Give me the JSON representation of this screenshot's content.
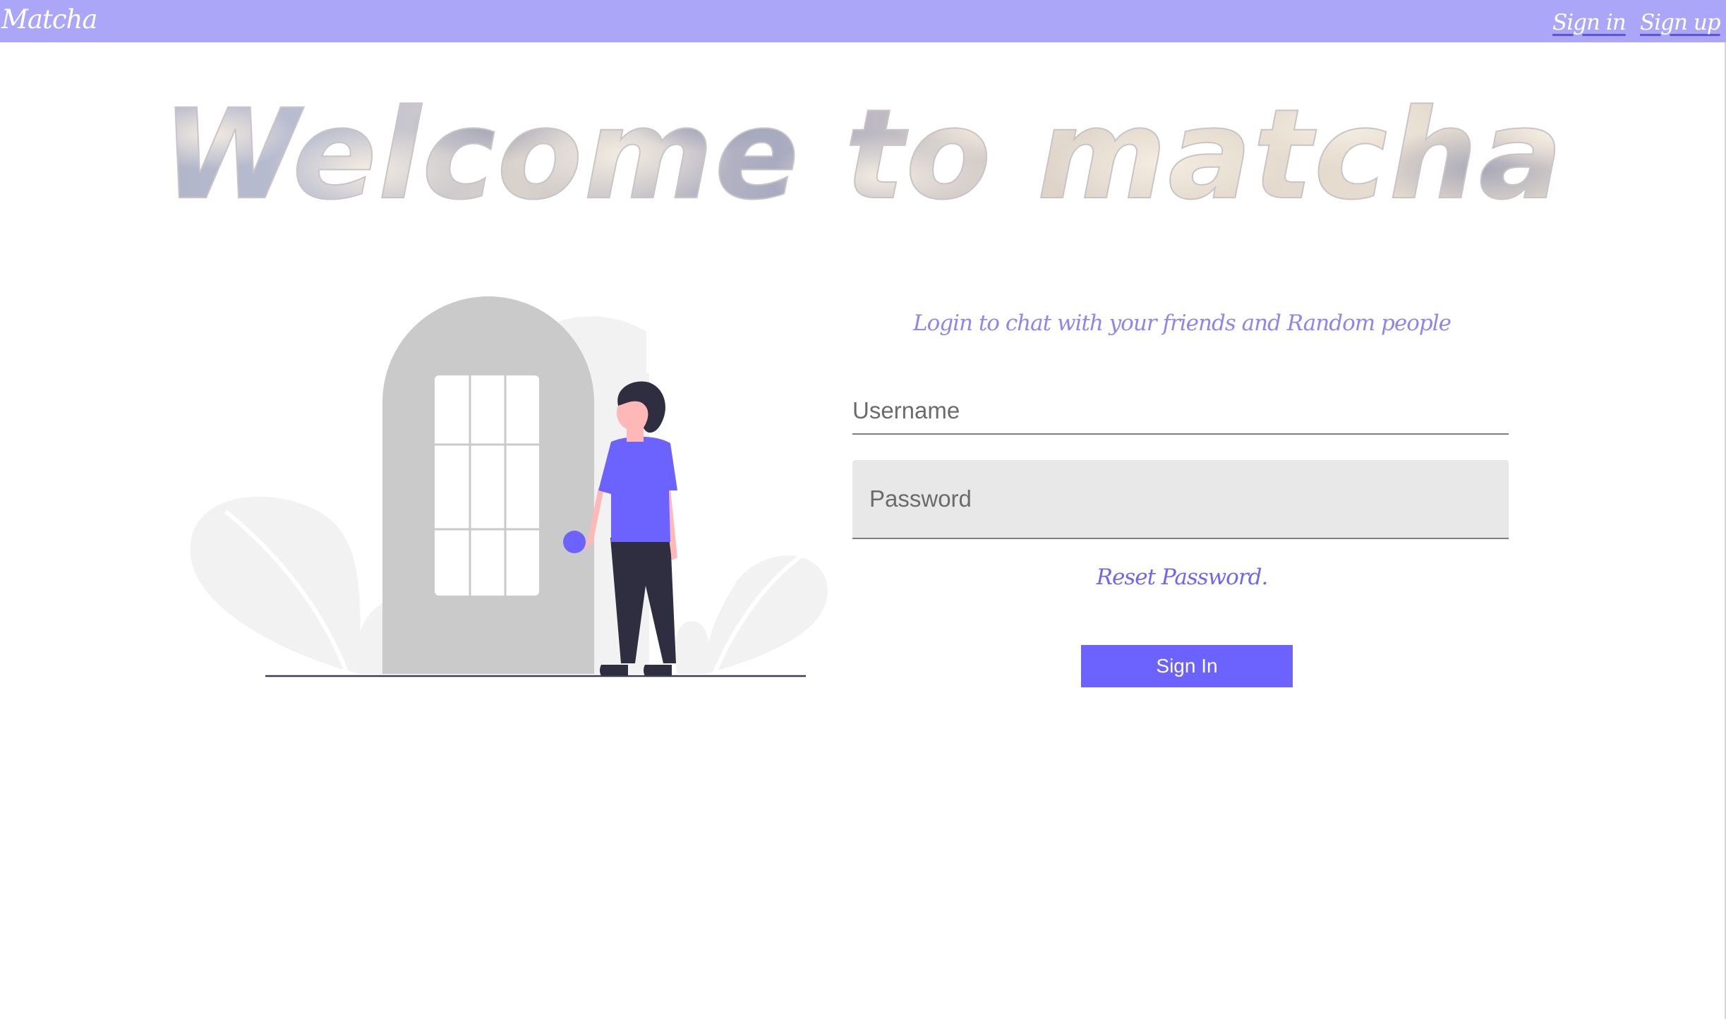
{
  "navbar": {
    "brand": "Matcha",
    "links": [
      {
        "label": "Sign in"
      },
      {
        "label": "Sign up"
      }
    ],
    "color": "#aba6f8"
  },
  "hero": {
    "title": "Welcome to matcha"
  },
  "login": {
    "tagline": "Login to chat with your friends and Random people",
    "username_placeholder": "Username",
    "username_value": "",
    "password_placeholder": "Password",
    "password_value": "",
    "reset_label": "Reset Password.",
    "submit_label": "Sign In",
    "accent_color": "#6c63ff"
  },
  "illustration": {
    "icon": "person-at-door-illustration"
  }
}
